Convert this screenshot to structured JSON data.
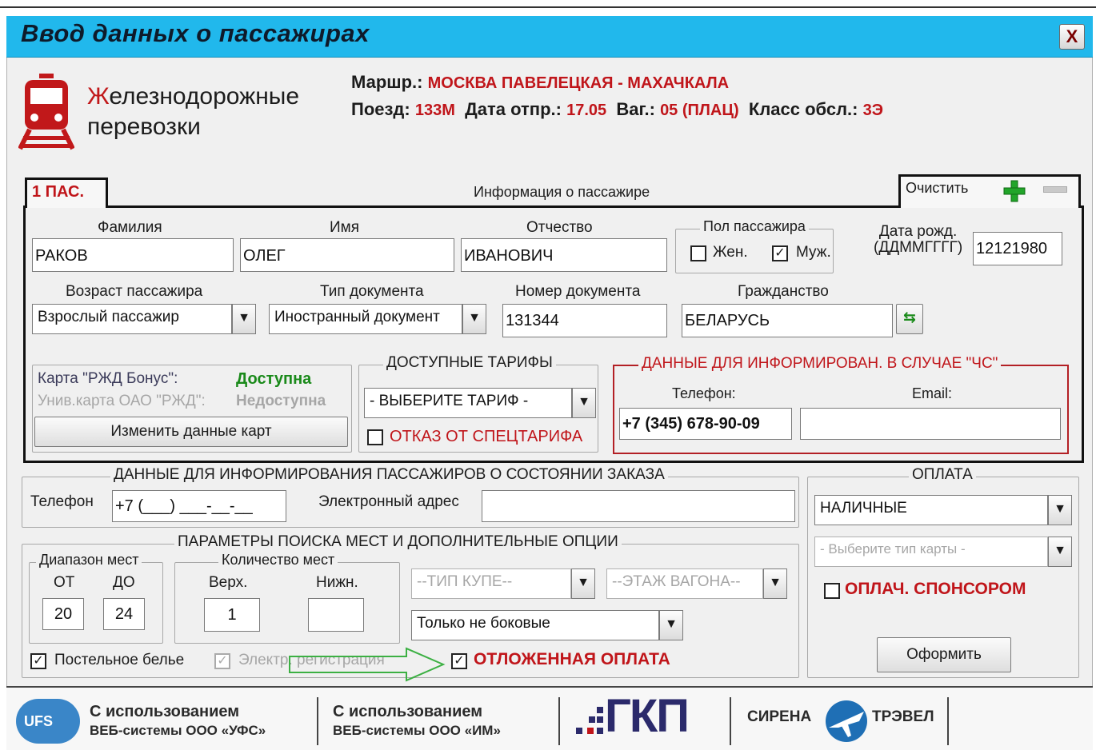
{
  "window": {
    "title": "Ввод данных о пассажирах",
    "close_label": "X"
  },
  "logo": {
    "first_letter": "Ж",
    "line1_rest": "елезнодорожные",
    "line2": "перевозки"
  },
  "route": {
    "route_label": "Маршр.:",
    "route_value": "МОСКВА ПАВЕЛЕЦКАЯ - МАХАЧКАЛА",
    "train_label": "Поезд:",
    "train_value": "133М",
    "date_label": "Дата отпр.:",
    "date_value": "17.05",
    "car_label": "Ваг.:",
    "car_value": "05 (ПЛАЦ)",
    "class_label": "Класс обсл.:",
    "class_value": "3Э"
  },
  "tab": {
    "label": "1 ПАС.",
    "panel_title": "Информация о пассажире",
    "clear_label": "Очистить"
  },
  "passenger": {
    "surname_label": "Фамилия",
    "surname_value": "РАКОВ",
    "name_label": "Имя",
    "name_value": "ОЛЕГ",
    "patronymic_label": "Отчество",
    "patronymic_value": "ИВАНОВИЧ",
    "gender_legend": "Пол пассажира",
    "female_label": "Жен.",
    "female_checked": false,
    "male_label": "Муж.",
    "male_checked": true,
    "birth_label_1": "Дата рожд.",
    "birth_label_2": "(ДДММГГГГ)",
    "birth_value": "12121980",
    "age_label": "Возраст пассажира",
    "age_value": "Взрослый пассажир",
    "doc_type_label": "Тип документа",
    "doc_type_value": "Иностранный документ",
    "doc_number_label": "Номер документа",
    "doc_number_value": "131344",
    "citizenship_label": "Гражданство",
    "citizenship_value": "БЕЛАРУСЬ"
  },
  "cards": {
    "bonus_label": "Карта \"РЖД Бонус\":",
    "bonus_value": "Доступна",
    "univ_label": "Унив.карта ОАО \"РЖД\":",
    "univ_value": "Недоступна",
    "change_button": "Изменить данные карт"
  },
  "tariffs": {
    "legend": "ДОСТУПНЫЕ ТАРИФЫ",
    "select_value": "- ВЫБЕРИТЕ ТАРИФ -",
    "refuse_label": "ОТКАЗ ОТ СПЕЦТАРИФА"
  },
  "emergency": {
    "legend": "ДАННЫЕ ДЛЯ ИНФОРМИРОВАН. В СЛУЧАЕ \"ЧС\"",
    "phone_label": "Телефон:",
    "phone_value": "+7 (345) 678-90-09",
    "email_label": "Email:",
    "email_value": ""
  },
  "order_info": {
    "legend": "ДАННЫЕ ДЛЯ ИНФОРМИРОВАНИЯ ПАССАЖИРОВ О СОСТОЯНИИ ЗАКАЗА",
    "phone_label": "Телефон",
    "phone_value": "+7 (___) ___-__-__",
    "email_label": "Электронный адрес",
    "email_value": ""
  },
  "payment": {
    "legend": "ОПЛАТА",
    "method_value": "НАЛИЧНЫЕ",
    "card_type_value": "- Выберите тип карты -",
    "sponsor_label": "ОПЛАЧ. СПОНСОРОМ",
    "submit_button": "Оформить"
  },
  "search": {
    "legend": "ПАРАМЕТРЫ ПОИСКА МЕСТ И ДОПОЛНИТЕЛЬНЫЕ ОПЦИИ",
    "range_legend": "Диапазон мест",
    "from_label": "ОТ",
    "to_label": "ДО",
    "from_value": "20",
    "to_value": "24",
    "count_legend": "Количество мест",
    "upper_label": "Верх.",
    "lower_label": "Нижн.",
    "upper_value": "1",
    "lower_value": "",
    "coupe_type": "--ТИП КУПЕ--",
    "floor": "--ЭТАЖ ВАГОНА--",
    "side_option": "Только не боковые",
    "linen_label": "Постельное белье",
    "ereg_label": "Электр. регистрация",
    "deferred_label": "ОТЛОЖЕННАЯ ОПЛАТА"
  },
  "footer": {
    "ufs_badge": "UFS",
    "ufs_line1": "С использованием",
    "ufs_line2": "ВЕБ-системы ООО «УФС»",
    "im_line1": "С использованием",
    "im_line2": "ВЕБ-системы ООО «ИМ»",
    "gkp_text": "ГКП",
    "sirena_left": "СИРЕНА",
    "sirena_right": "ТРЭВЕЛ"
  },
  "colors": {
    "titlebar": "#21b8ec",
    "accent_red": "#c0151a",
    "available_green": "#1a8a1a",
    "arrow_green": "#3cb043"
  }
}
